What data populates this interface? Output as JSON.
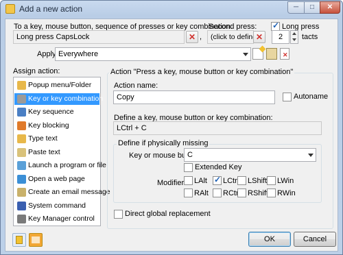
{
  "window": {
    "title": "Add a new action",
    "minimize_glyph": "─",
    "maximize_glyph": "□",
    "close_glyph": "✕"
  },
  "first_press": {
    "label": "To a key, mouse button, sequence of presses or key combination:",
    "value": "Long press CapsLock",
    "separator": ","
  },
  "second_press": {
    "label": "Second press:",
    "value": "(click to define)"
  },
  "long_press": {
    "label": "Long press",
    "checked": true,
    "count": "2",
    "unit": "tacts"
  },
  "apply": {
    "label": "Apply",
    "value": "Everywhere"
  },
  "assign_action": {
    "label": "Assign action:",
    "items": [
      {
        "label": "Popup menu/Folder",
        "icon": "folder-icon",
        "color": "#e8b84a"
      },
      {
        "label": "Key or key combination",
        "icon": "keyboard-icon",
        "color": "#9a9a9a",
        "selected": true
      },
      {
        "label": "Key sequence",
        "icon": "key-sequence-icon",
        "color": "#4a7fc4"
      },
      {
        "label": "Key blocking",
        "icon": "key-blocking-icon",
        "color": "#e07a2a"
      },
      {
        "label": "Type text",
        "icon": "type-text-icon",
        "color": "#e8b84a"
      },
      {
        "label": "Paste text",
        "icon": "paste-text-icon",
        "color": "#d9c27a"
      },
      {
        "label": "Launch a program or file",
        "icon": "launch-program-icon",
        "color": "#5aa0d8"
      },
      {
        "label": "Open a web page",
        "icon": "globe-icon",
        "color": "#3b8fd6"
      },
      {
        "label": "Create an email message",
        "icon": "email-icon",
        "color": "#c9b16a"
      },
      {
        "label": "System command",
        "icon": "system-command-icon",
        "color": "#3a5fb0"
      },
      {
        "label": "Key Manager control",
        "icon": "key-manager-icon",
        "color": "#7a7a7a"
      }
    ]
  },
  "action_panel": {
    "title": "Action \"Press a key, mouse button or key combination\"",
    "name_label": "Action name:",
    "name_value": "Copy",
    "autoname_label": "Autoname",
    "define_label": "Define a key, mouse button or key combination:",
    "define_value": "LCtrl + C",
    "missing_group": "Define if physically missing",
    "key_label": "Key or mouse button",
    "key_value": "C",
    "extended_key": "Extended Key",
    "modifiers_label": "Modifiers",
    "modifiers": [
      {
        "label": "LAlt",
        "checked": false
      },
      {
        "label": "LCtrl",
        "checked": true
      },
      {
        "label": "LShift",
        "checked": false
      },
      {
        "label": "LWin",
        "checked": false
      },
      {
        "label": "RAlt",
        "checked": false
      },
      {
        "label": "RCtrl",
        "checked": false
      },
      {
        "label": "RShift",
        "checked": false
      },
      {
        "label": "RWin",
        "checked": false
      }
    ],
    "direct_global": "Direct global replacement"
  },
  "footer": {
    "ok_label": "OK",
    "cancel_label": "Cancel"
  }
}
